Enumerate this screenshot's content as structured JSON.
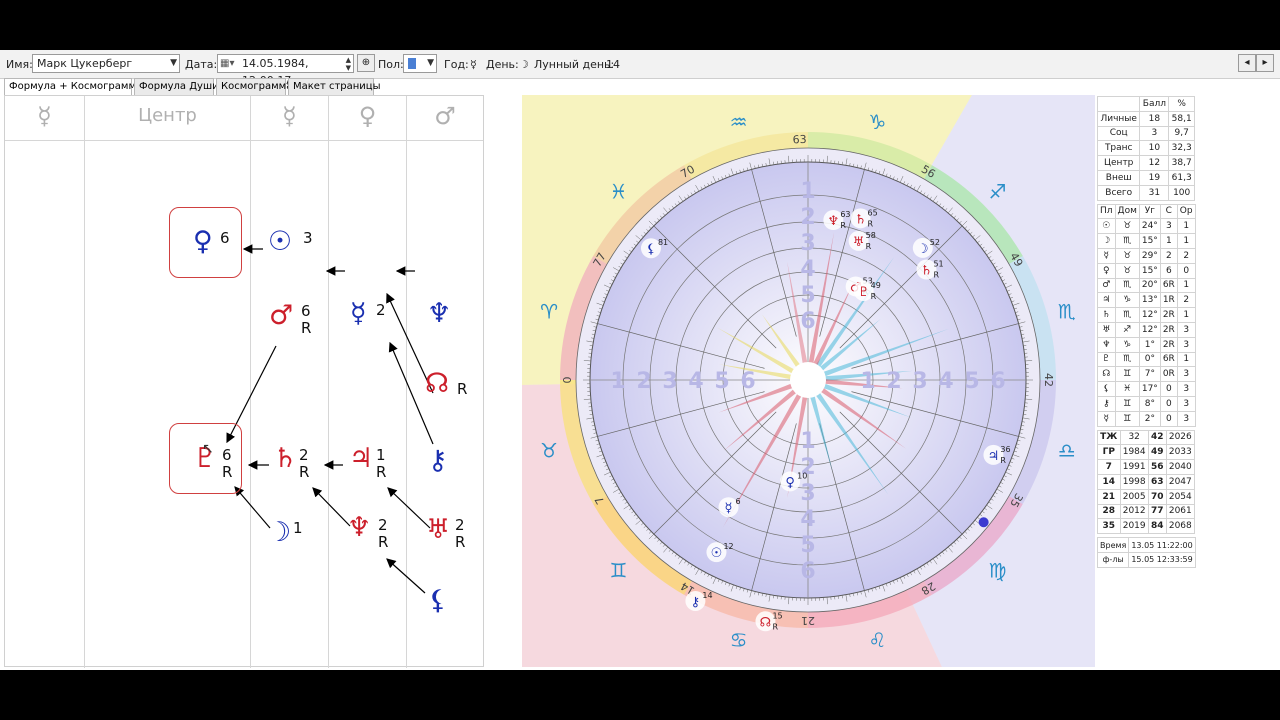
{
  "toolbar": {
    "name_label": "Имя:",
    "name_value": "Марк Цукерберг",
    "date_label": "Дата:",
    "date_value": "14.05.1984, 12:00:17",
    "sex_label": "Пол:",
    "year_label": "Год:",
    "year_value": "☿",
    "day_label": "День:",
    "day_value": "☽",
    "lunar_label": "Лунный день:",
    "lunar_value": "14",
    "nav_prev": "◂",
    "nav_next": "▸"
  },
  "tabs": [
    "Формула + Космограмма",
    "Формула Души",
    "Космограмма",
    "Макет страницы"
  ],
  "formula": {
    "headers": [
      "☿",
      "Центр",
      "☿",
      "♀",
      "♂"
    ],
    "nodes": [
      {
        "sym": "♀",
        "n": "6",
        "r": "",
        "color": "blue"
      },
      {
        "sym": "☉",
        "n": "3",
        "r": "",
        "color": "blue"
      },
      {
        "sym": "♂",
        "n": "6",
        "r": "R",
        "color": "red"
      },
      {
        "sym": "☿",
        "n": "2",
        "r": "",
        "color": "blue"
      },
      {
        "sym": "♆",
        "n": "",
        "r": "",
        "color": "blue"
      },
      {
        "sym": "☊",
        "n": "",
        "r": "R",
        "color": "red"
      },
      {
        "sym": "♇",
        "n": "6",
        "r": "R",
        "color": "red"
      },
      {
        "sym": "♄",
        "n": "2",
        "r": "R",
        "color": "red"
      },
      {
        "sym": "♃",
        "n": "1",
        "r": "R",
        "color": "red"
      },
      {
        "sym": "⚷",
        "n": "",
        "r": "",
        "color": "blue"
      },
      {
        "sym": "☽",
        "n": "1",
        "r": "",
        "color": "blue"
      },
      {
        "sym": "♆",
        "n": "2",
        "r": "R",
        "color": "red"
      },
      {
        "sym": "♅",
        "n": "2",
        "r": "R",
        "color": "red"
      },
      {
        "sym": "⚸",
        "n": "",
        "r": "",
        "color": "blue"
      }
    ]
  },
  "chart": {
    "cusp_labels": [
      "63",
      "56",
      "49",
      "42",
      "35",
      "28",
      "21",
      "14",
      "7",
      "0",
      "77",
      "70"
    ],
    "sign_glyphs": [
      "♑",
      "♐",
      "♏",
      "♎",
      "♍",
      "♌",
      "♋",
      "♊",
      "♉",
      "♈",
      "♓",
      "♒"
    ],
    "house_numbers": [
      "1",
      "2",
      "3",
      "4",
      "5",
      "6"
    ],
    "planets": [
      {
        "sym": "♄",
        "deg": "65",
        "r": "R"
      },
      {
        "sym": "♆",
        "deg": "63",
        "r": "R"
      },
      {
        "sym": "♅",
        "deg": "58",
        "r": "R"
      },
      {
        "sym": "☽",
        "deg": "52",
        "r": ""
      },
      {
        "sym": "♄",
        "deg": "51",
        "r": "R"
      },
      {
        "sym": "♂",
        "deg": "53",
        "r": "R"
      },
      {
        "sym": "♇",
        "deg": "49",
        "r": "R"
      },
      {
        "sym": "⚸",
        "deg": "81",
        "r": ""
      },
      {
        "sym": "♀",
        "deg": "10",
        "r": ""
      },
      {
        "sym": "☿",
        "deg": "6",
        "r": ""
      },
      {
        "sym": "☉",
        "deg": "12",
        "r": ""
      },
      {
        "sym": "⚷",
        "deg": "14",
        "r": ""
      },
      {
        "sym": "☊",
        "deg": "15",
        "r": "R"
      },
      {
        "sym": "♃",
        "deg": "36",
        "r": "R"
      }
    ]
  },
  "stats": {
    "header": [
      "",
      "Балл",
      "%"
    ],
    "rows": [
      [
        "Личные",
        "18",
        "58,1"
      ],
      [
        "Соц",
        "3",
        "9,7"
      ],
      [
        "Транс",
        "10",
        "32,3"
      ],
      [
        "Центр",
        "12",
        "38,7"
      ],
      [
        "Внеш",
        "19",
        "61,3"
      ],
      [
        "Всего",
        "31",
        "100"
      ]
    ]
  },
  "planets_table": {
    "header": [
      "Пл",
      "Дом",
      "Уг",
      "С",
      "Ор"
    ],
    "rows": [
      [
        "☉",
        "♉",
        "24°",
        "3",
        "1"
      ],
      [
        "☽",
        "♏",
        "15°",
        "1",
        "1"
      ],
      [
        "☿",
        "♉",
        "29°",
        "2",
        "2"
      ],
      [
        "♀",
        "♉",
        "15°",
        "6",
        "0"
      ],
      [
        "♂",
        "♏",
        "20°",
        "6R",
        "1"
      ],
      [
        "♃",
        "♑",
        "13°",
        "1R",
        "2"
      ],
      [
        "♄",
        "♏",
        "12°",
        "2R",
        "1"
      ],
      [
        "♅",
        "♐",
        "12°",
        "2R",
        "3"
      ],
      [
        "♆",
        "♑",
        "1°",
        "2R",
        "3"
      ],
      [
        "♇",
        "♏",
        "0°",
        "6R",
        "1"
      ],
      [
        "☊",
        "♊",
        "7°",
        "0R",
        "3"
      ],
      [
        "⚸",
        "♓",
        "17°",
        "0",
        "3"
      ],
      [
        "⚷",
        "♊",
        "8°",
        "0",
        "3"
      ],
      [
        "☿",
        "♊",
        "2°",
        "0",
        "3"
      ]
    ]
  },
  "cycles": {
    "rows": [
      [
        "ТЖ",
        "32",
        "42",
        "2026"
      ],
      [
        "ГР",
        "1984",
        "49",
        "2033"
      ],
      [
        "7",
        "1991",
        "56",
        "2040"
      ],
      [
        "14",
        "1998",
        "63",
        "2047"
      ],
      [
        "21",
        "2005",
        "70",
        "2054"
      ],
      [
        "28",
        "2012",
        "77",
        "2061"
      ],
      [
        "35",
        "2019",
        "84",
        "2068"
      ]
    ]
  },
  "times": {
    "rows": [
      [
        "Время",
        "13.05 11:22:00"
      ],
      [
        "ф-лы",
        "15.05 12:33:59"
      ]
    ]
  },
  "colors": {
    "red": "#cc1f2b",
    "blue": "#1a2fb0",
    "accent": "#5aa0e0"
  }
}
